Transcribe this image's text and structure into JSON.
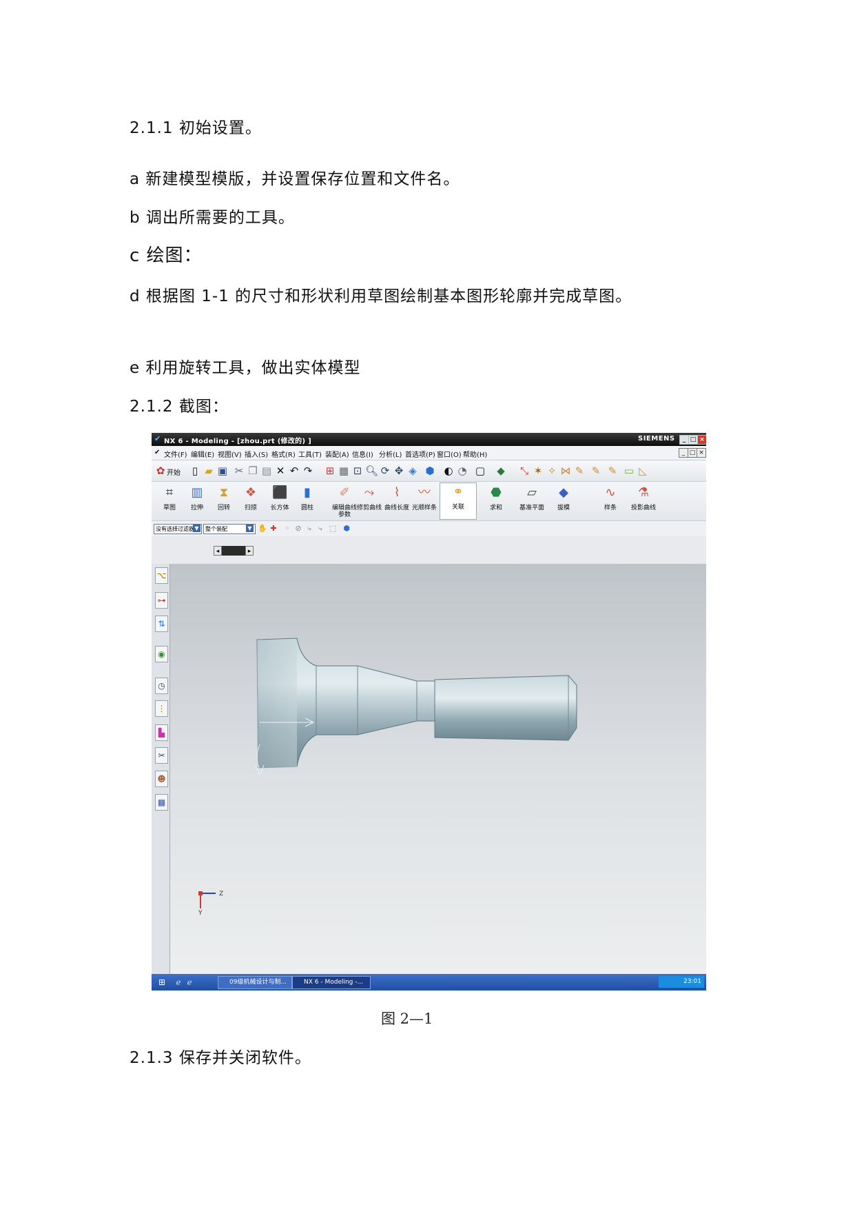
{
  "doc": {
    "h_initial": "2.1.1 初始设置。",
    "step_a": "a 新建模型模版，并设置保存位置和文件名。",
    "step_b": "b 调出所需要的工具。",
    "step_c": "c 绘图：",
    "step_d": "d 根据图 1-1 的尺寸和形状利用草图绘制基本图形轮廓并完成草图。",
    "step_e": "e 利用旋转工具，做出实体模型",
    "h_screenshot": "2.1.2 截图：",
    "caption": "图 2—1",
    "h_save": "2.1.3 保存并关闭软件。"
  },
  "nx": {
    "title": "NX 6 - Modeling - [zhou.prt (修改的) ]",
    "brand": "SIEMENS",
    "menu": [
      "文件(F)",
      "编辑(E)",
      "视图(V)",
      "插入(S)",
      "格式(R)",
      "工具(T)",
      "装配(A)",
      "信息(I)",
      "分析(L)",
      "首选项(P)",
      "窗口(O)",
      "帮助(H)"
    ],
    "start_label": "开始",
    "tools": [
      "草图",
      "拉伸",
      "回转",
      "扫掠",
      "长方体",
      "圆柱",
      "编辑曲线参数",
      "修剪曲线",
      "曲线长度",
      "光顺样条",
      "关联",
      "求和",
      "基准平面",
      "拔模",
      "样条",
      "投影曲线"
    ],
    "filter": "没有选择过滤器",
    "assembly": "整个装配",
    "axis_z": "Z",
    "axis_y": "Y",
    "taskbar": [
      "09级机械设计与制...",
      "NX 6 - Modeling -..."
    ],
    "clock": "23:01"
  },
  "colors": {
    "title_bar": "#111111",
    "viewport_top": "#bfc4c9",
    "viewport_bottom": "#eceeef",
    "model": "#8fa7b1",
    "taskbar": "#2a5cb5"
  }
}
